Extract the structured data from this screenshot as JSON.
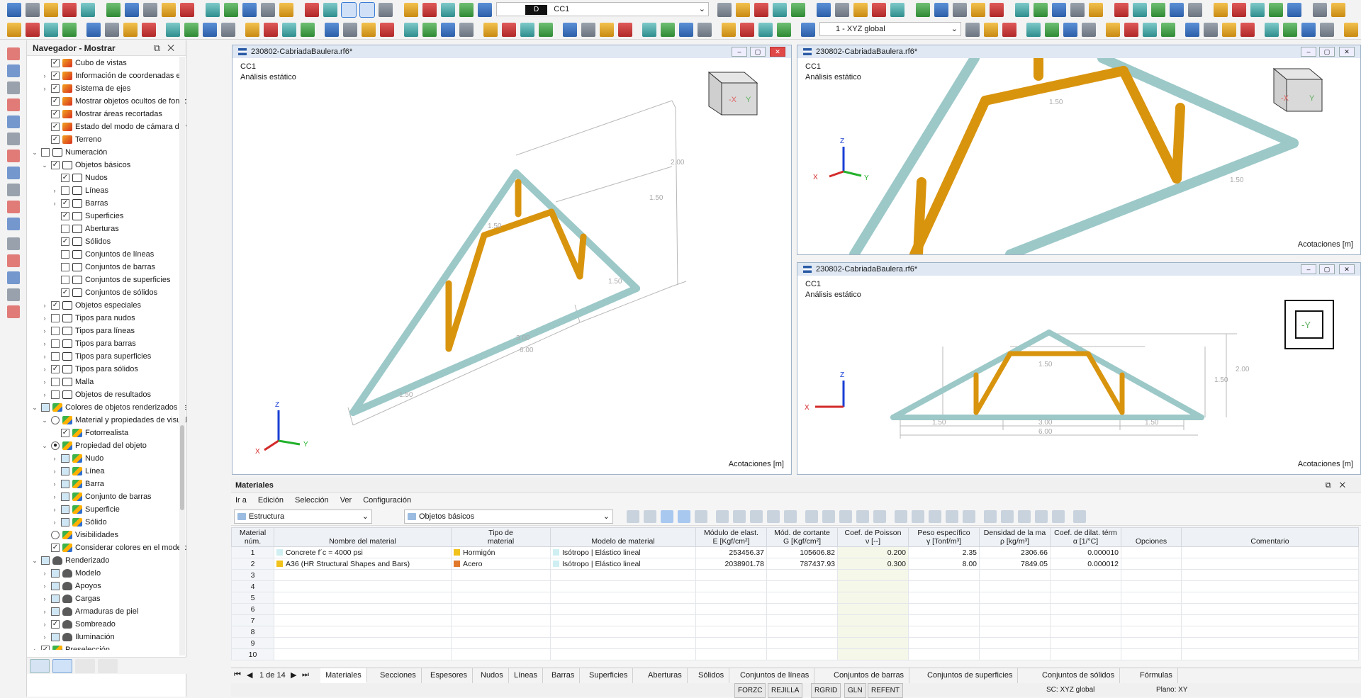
{
  "toolbar": {
    "load_case_code": "D",
    "load_case_name": "CC1",
    "coord_system": "1 - XYZ global"
  },
  "navigator": {
    "title": "Navegador - Mostrar",
    "items": [
      {
        "label": "Cubo de vistas",
        "level": 2,
        "check": "✓",
        "icon": "cube"
      },
      {
        "label": "Información de coordenadas en ...",
        "level": 2,
        "check": "✓",
        "icon": "cube",
        "exp": "›"
      },
      {
        "label": "Sistema de ejes",
        "level": 2,
        "check": "✓",
        "icon": "cube",
        "exp": "›"
      },
      {
        "label": "Mostrar objetos ocultos de fondo",
        "level": 2,
        "check": "✓",
        "icon": "cube"
      },
      {
        "label": "Mostrar áreas recortadas",
        "level": 2,
        "check": "✓",
        "icon": "cube"
      },
      {
        "label": "Estado del modo de cámara de v...",
        "level": 2,
        "check": "✓",
        "icon": "cube"
      },
      {
        "label": "Terreno",
        "level": 2,
        "check": "✓",
        "icon": "cube"
      },
      {
        "label": "Numeración",
        "level": 1,
        "check": "",
        "icon": "num",
        "exp": "⌄"
      },
      {
        "label": "Objetos básicos",
        "level": 2,
        "check": "✓",
        "icon": "num",
        "exp": "⌄"
      },
      {
        "label": "Nudos",
        "level": 3,
        "check": "✓",
        "icon": "num"
      },
      {
        "label": "Líneas",
        "level": 3,
        "check": "",
        "icon": "num",
        "exp": "›"
      },
      {
        "label": "Barras",
        "level": 3,
        "check": "✓",
        "icon": "num",
        "exp": "›"
      },
      {
        "label": "Superficies",
        "level": 3,
        "check": "✓",
        "icon": "num"
      },
      {
        "label": "Aberturas",
        "level": 3,
        "check": "",
        "icon": "num"
      },
      {
        "label": "Sólidos",
        "level": 3,
        "check": "✓",
        "icon": "num"
      },
      {
        "label": "Conjuntos de líneas",
        "level": 3,
        "check": "",
        "icon": "num"
      },
      {
        "label": "Conjuntos de barras",
        "level": 3,
        "check": "",
        "icon": "num"
      },
      {
        "label": "Conjuntos de superficies",
        "level": 3,
        "check": "",
        "icon": "num"
      },
      {
        "label": "Conjuntos de sólidos",
        "level": 3,
        "check": "✓",
        "icon": "num"
      },
      {
        "label": "Objetos especiales",
        "level": 2,
        "check": "✓",
        "icon": "num",
        "exp": "›"
      },
      {
        "label": "Tipos para nudos",
        "level": 2,
        "check": "",
        "icon": "num",
        "exp": "›"
      },
      {
        "label": "Tipos para líneas",
        "level": 2,
        "check": "",
        "icon": "num",
        "exp": "›"
      },
      {
        "label": "Tipos para barras",
        "level": 2,
        "check": "",
        "icon": "num",
        "exp": "›"
      },
      {
        "label": "Tipos para superficies",
        "level": 2,
        "check": "",
        "icon": "num",
        "exp": "›"
      },
      {
        "label": "Tipos para sólidos",
        "level": 2,
        "check": "✓",
        "icon": "num",
        "exp": "›"
      },
      {
        "label": "Malla",
        "level": 2,
        "check": "",
        "icon": "num",
        "exp": "›"
      },
      {
        "label": "Objetos de resultados",
        "level": 2,
        "check": "",
        "icon": "num",
        "exp": "›"
      },
      {
        "label": "Colores de objetos renderizados seg...",
        "level": 1,
        "check": "",
        "icon": "col",
        "exp": "⌄",
        "partial": true
      },
      {
        "label": "Material y propiedades de visuali...",
        "level": 2,
        "check": "",
        "icon": "col",
        "exp": "⌄",
        "radio": true
      },
      {
        "label": "Fotorrealista",
        "level": 3,
        "check": "✓",
        "icon": "col"
      },
      {
        "label": "Propiedad del objeto",
        "level": 2,
        "check": "●",
        "icon": "col",
        "exp": "⌄",
        "radio": true
      },
      {
        "label": "Nudo",
        "level": 3,
        "check": "",
        "icon": "col",
        "exp": "›",
        "partial": true
      },
      {
        "label": "Línea",
        "level": 3,
        "check": "",
        "icon": "col",
        "exp": "›",
        "partial": true
      },
      {
        "label": "Barra",
        "level": 3,
        "check": "",
        "icon": "col",
        "exp": "›",
        "partial": true
      },
      {
        "label": "Conjunto de barras",
        "level": 3,
        "check": "",
        "icon": "col",
        "exp": "›",
        "partial": true
      },
      {
        "label": "Superficie",
        "level": 3,
        "check": "",
        "icon": "col",
        "exp": "›",
        "partial": true
      },
      {
        "label": "Sólido",
        "level": 3,
        "check": "",
        "icon": "col",
        "exp": "›",
        "partial": true
      },
      {
        "label": "Visibilidades",
        "level": 2,
        "check": "",
        "icon": "col",
        "radio": true
      },
      {
        "label": "Considerar colores en el modelo ...",
        "level": 2,
        "check": "✓",
        "icon": "col"
      },
      {
        "label": "Renderizado",
        "level": 1,
        "check": "",
        "icon": "tea",
        "exp": "⌄",
        "partial": true
      },
      {
        "label": "Modelo",
        "level": 2,
        "check": "",
        "icon": "tea",
        "exp": "›",
        "partial": true
      },
      {
        "label": "Apoyos",
        "level": 2,
        "check": "",
        "icon": "tea",
        "exp": "›",
        "partial": true
      },
      {
        "label": "Cargas",
        "level": 2,
        "check": "",
        "icon": "tea",
        "exp": "›",
        "partial": true
      },
      {
        "label": "Armaduras de piel",
        "level": 2,
        "check": "",
        "icon": "tea",
        "exp": "›",
        "partial": true
      },
      {
        "label": "Sombreado",
        "level": 2,
        "check": "✓",
        "icon": "tea",
        "exp": "›"
      },
      {
        "label": "Iluminación",
        "level": 2,
        "check": "",
        "icon": "tea",
        "exp": "›",
        "partial": true
      },
      {
        "label": "Preselección",
        "level": 1,
        "check": "✓",
        "icon": "col",
        "exp": "›"
      }
    ]
  },
  "viewports": {
    "main": {
      "title": "230802-CabriadaBaulera.rf6*",
      "load_case": "CC1",
      "analysis": "Análisis estático",
      "dims": "Acotaciones [m]"
    },
    "top_right": {
      "title": "230802-CabriadaBaulera.rf6*",
      "load_case": "CC1",
      "analysis": "Análisis estático",
      "dims": "Acotaciones [m]"
    },
    "bottom_right": {
      "title": "230802-CabriadaBaulera.rf6*",
      "load_case": "CC1",
      "analysis": "Análisis estático",
      "dims": "Acotaciones [m]"
    }
  },
  "dims": {
    "d150": "1.50",
    "d200": "2.00",
    "d300": "3.00",
    "d600": "6.00"
  },
  "axes": {
    "x": "X",
    "y": "Y",
    "z": "Z"
  },
  "viewcube": {
    "neg_x": "-X",
    "y": "Y",
    "neg_y": "-Y"
  },
  "materials": {
    "title": "Materiales",
    "menu": [
      "Ir a",
      "Edición",
      "Selección",
      "Ver",
      "Configuración"
    ],
    "combo1": "Estructura",
    "combo2": "Objetos básicos",
    "headers": {
      "num": [
        "Material",
        "núm."
      ],
      "name": "Nombre del material",
      "type": [
        "Tipo de",
        "material"
      ],
      "model": "Modelo de material",
      "e": [
        "Módulo de elast.",
        "E [Kgf/cm²]"
      ],
      "g": [
        "Mód. de cortante",
        "G [Kgf/cm²]"
      ],
      "poisson": [
        "Coef. de Poisson",
        "ν [--]"
      ],
      "weight": [
        "Peso específico",
        "γ [Tonf/m³]"
      ],
      "density": [
        "Densidad de la ma",
        "ρ [kg/m³]"
      ],
      "alpha": [
        "Coef. de dilat. térm",
        "α [1/°C]"
      ],
      "options": "Opciones",
      "comment": "Comentario"
    },
    "rows": [
      {
        "num": "1",
        "name": "Concrete f´c = 4000 psi",
        "name_color": "#cfeff2",
        "type": "Hormigón",
        "type_color": "#f0c21b",
        "model": "Isótropo | Elástico lineal",
        "e": "253456.37",
        "g": "105606.82",
        "nu": "0.200",
        "w": "2.35",
        "rho": "2306.66",
        "alpha": "0.000010"
      },
      {
        "num": "2",
        "name": "A36 (HR Structural Shapes and Bars)",
        "name_color": "#f0c21b",
        "type": "Acero",
        "type_color": "#e0792c",
        "model": "Isótropo | Elástico lineal",
        "e": "2038901.78",
        "g": "787437.93",
        "nu": "0.300",
        "w": "8.00",
        "rho": "7849.05",
        "alpha": "0.000012"
      }
    ],
    "empty_rows": [
      "3",
      "4",
      "5",
      "6",
      "7",
      "8",
      "9",
      "10"
    ],
    "pager": "1 de 14",
    "tabs": [
      "Materiales",
      "Secciones",
      "Espesores",
      "Nudos",
      "Líneas",
      "Barras",
      "Superficies",
      "Aberturas",
      "Sólidos",
      "Conjuntos de líneas",
      "Conjuntos de barras",
      "Conjuntos de superficies",
      "Conjuntos de sólidos",
      "Fórmulas"
    ]
  },
  "status": {
    "buttons": [
      "FORZC",
      "REJILLA",
      "RGRID",
      "GLN",
      "REFENT"
    ],
    "sc": "SC: XYZ global",
    "plane": "Plano: XY"
  }
}
